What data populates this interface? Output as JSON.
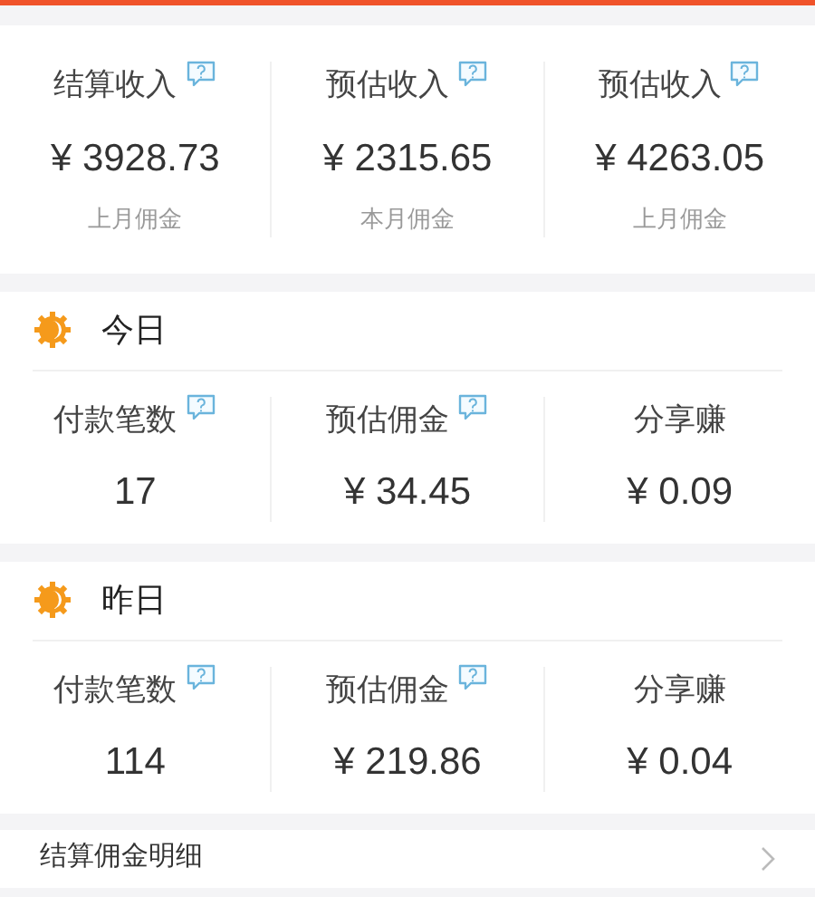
{
  "summary": [
    {
      "label": "结算收入",
      "help": true,
      "value": "¥ 3928.73",
      "note": "上月佣金"
    },
    {
      "label": "预估收入",
      "help": true,
      "value": "¥ 2315.65",
      "note": "本月佣金"
    },
    {
      "label": "预估收入",
      "help": true,
      "value": "¥ 4263.05",
      "note": "上月佣金"
    }
  ],
  "sections": [
    {
      "title": "今日",
      "stats": [
        {
          "label": "付款笔数",
          "help": true,
          "value": "17"
        },
        {
          "label": "预估佣金",
          "help": true,
          "value": "¥ 34.45"
        },
        {
          "label": "分享赚",
          "help": false,
          "value": "¥ 0.09"
        }
      ]
    },
    {
      "title": "昨日",
      "stats": [
        {
          "label": "付款笔数",
          "help": true,
          "value": "114"
        },
        {
          "label": "预估佣金",
          "help": true,
          "value": "¥ 219.86"
        },
        {
          "label": "分享赚",
          "help": false,
          "value": "¥ 0.04"
        }
      ]
    }
  ],
  "link_row": {
    "label": "结算佣金明细"
  }
}
